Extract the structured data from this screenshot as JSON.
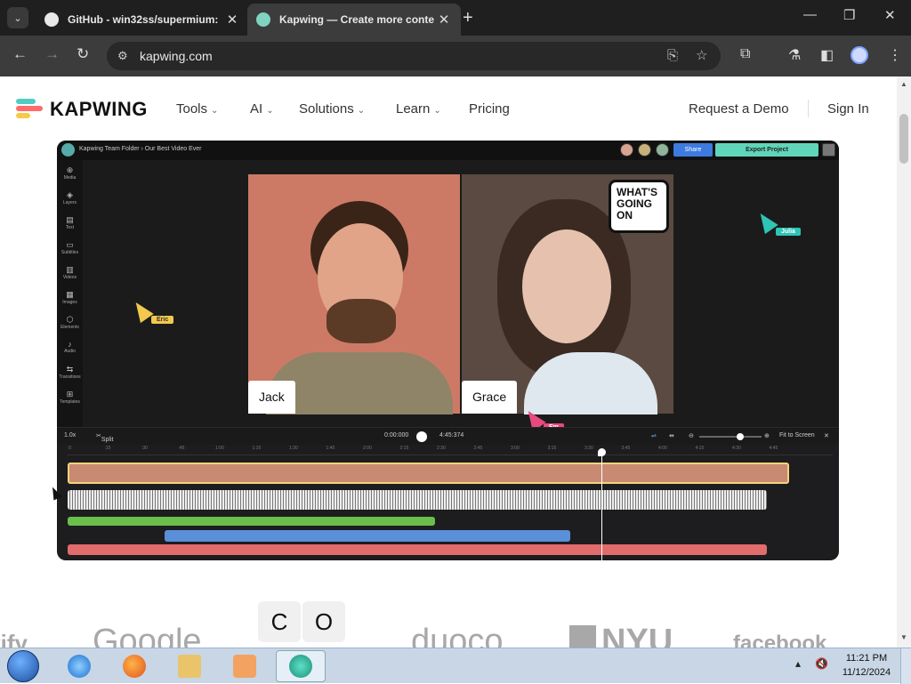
{
  "browser": {
    "tabs": [
      {
        "title": "GitHub - win32ss/supermium:",
        "favicon_color": "#e8e8e8",
        "active": false
      },
      {
        "title": "Kapwing — Create more conte",
        "favicon_color": "#7fd3c0",
        "active": true
      }
    ],
    "url": "kapwing.com",
    "controls": {
      "new_tab": "+",
      "minimize": "—",
      "maximize": "❐",
      "close": "✕"
    }
  },
  "site": {
    "brand": "KAPWING",
    "logo_colors": [
      "#ff6b6b",
      "#f7c948",
      "#4ecdc4"
    ],
    "nav": [
      {
        "label": "Tools",
        "has_dropdown": true
      },
      {
        "label": "AI",
        "has_dropdown": true
      },
      {
        "label": "Solutions",
        "has_dropdown": true
      },
      {
        "label": "Learn",
        "has_dropdown": true
      },
      {
        "label": "Pricing",
        "has_dropdown": false
      }
    ],
    "request_demo": "Request a Demo",
    "sign_in": "Sign In"
  },
  "editor": {
    "breadcrumb": "Kapwing Team Folder › Our Best Video Ever",
    "share_label": "Share",
    "export_label": "Export Project",
    "sidebar": [
      "Media",
      "Layers",
      "Text",
      "Subtitles",
      "Videos",
      "Images",
      "Elements",
      "Audio",
      "Transitions",
      "Templates"
    ],
    "left_person": "Jack",
    "right_person": "Grace",
    "bubble_text": "WHAT'S GOING ON",
    "cursors": [
      {
        "name": "Eric",
        "color": "#f2c94c"
      },
      {
        "name": "Julia",
        "color": "#2ec4b6"
      },
      {
        "name": "Em",
        "color": "#e84a7f"
      }
    ],
    "timeline": {
      "speed": "1.0x",
      "split": "Split",
      "time_current": "0:00:000",
      "time_total": "4:45:374",
      "fit_label": "Fit to Screen",
      "ruler": [
        ":0",
        ":15",
        ":30",
        ":45",
        "1:00",
        "1:15",
        "1:30",
        "1:45",
        "2:00",
        "2:15",
        "2:30",
        "2:45",
        "3:00",
        "3:15",
        "3:30",
        "3:45",
        "4:00",
        "4:15",
        "4:30",
        "4:45"
      ],
      "track_colors": {
        "video": "#c98a74",
        "audio": "#e8e8e8",
        "green": "#6abf4b",
        "blue": "#5b8fd9",
        "red": "#e06c6c"
      }
    }
  },
  "logos": [
    "tify",
    "Google",
    "C",
    "O",
    "duoco",
    "NYU",
    "facebook"
  ],
  "taskbar": {
    "time": "11:21 PM",
    "date": "11/12/2024"
  }
}
